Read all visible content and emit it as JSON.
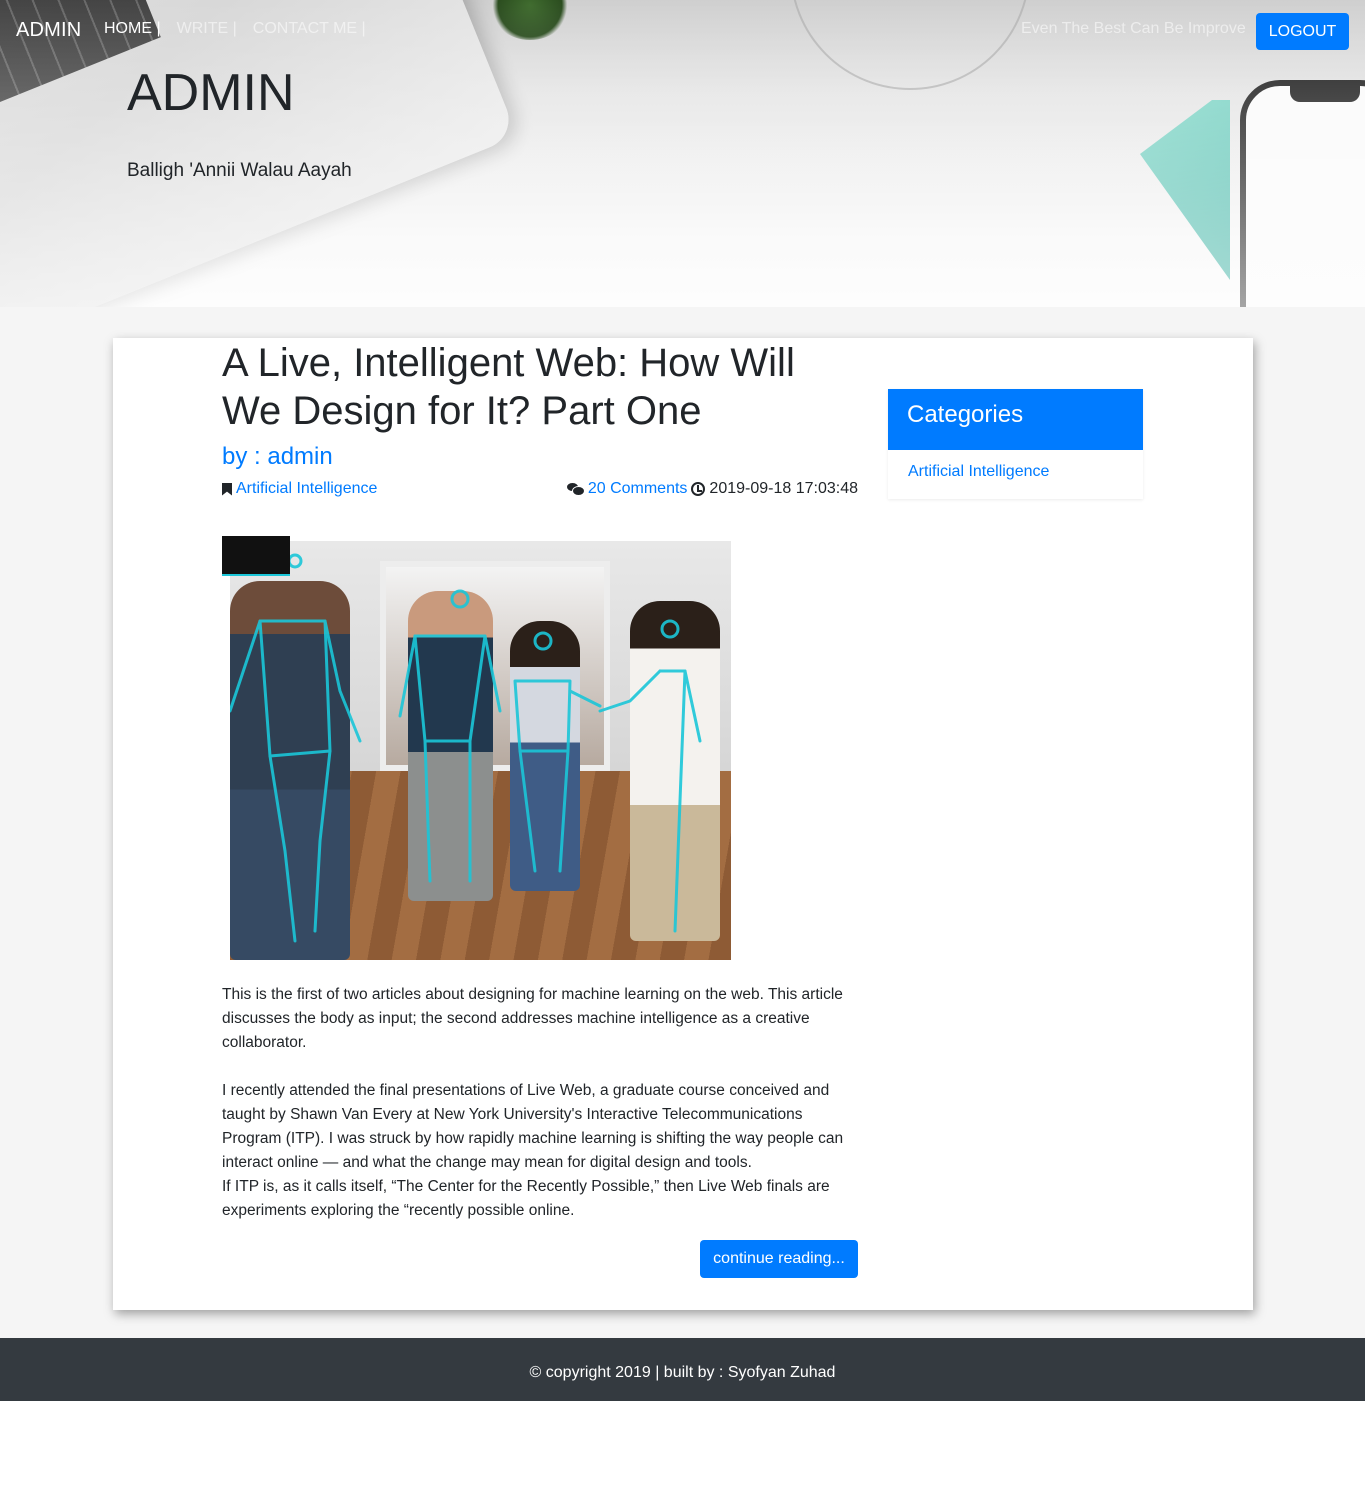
{
  "nav": {
    "brand": "ADMIN",
    "links": [
      "HOME |",
      "WRITE |",
      "CONTACT ME |"
    ],
    "tagline": "Even The Best Can Be Improve",
    "logout_label": "LOGOUT"
  },
  "hero": {
    "title": "ADMIN",
    "subtitle": "Balligh 'Annii Walau Aayah"
  },
  "post": {
    "title": "A Live, Intelligent Web: How Will We Design for It? Part One",
    "author": "by : admin",
    "category": "Artificial Intelligence",
    "comments": "20 Comments",
    "date": "2019-09-18 17:03:48",
    "paragraphs": [
      "This is the first of two articles about designing for machine learning on the web. This article discusses the body as input; the second addresses machine intelligence as a creative collaborator.",
      "I recently attended the final presentations of Live Web, a graduate course conceived and taught by Shawn Van Every at New York University's Interactive Telecommunications Program (ITP). I was struck by how rapidly machine learning is shifting the way people can interact online — and what the change may mean for digital design and tools.",
      "If ITP is, as it calls itself, “The Center for the Recently Possible,” then Live Web finals are experiments exploring the “recently possible online."
    ],
    "continue_label": "continue reading..."
  },
  "sidebar": {
    "heading": "Categories",
    "items": [
      "Artificial Intelligence"
    ]
  },
  "footer": {
    "text": "© copyright 2019 | built by : Syofyan Zuhad"
  },
  "colors": {
    "primary": "#007bff",
    "footer_bg": "#343a40",
    "skeleton": "#1bc6d8"
  },
  "icons": [
    "bookmark-icon",
    "comments-icon",
    "clock-icon"
  ]
}
